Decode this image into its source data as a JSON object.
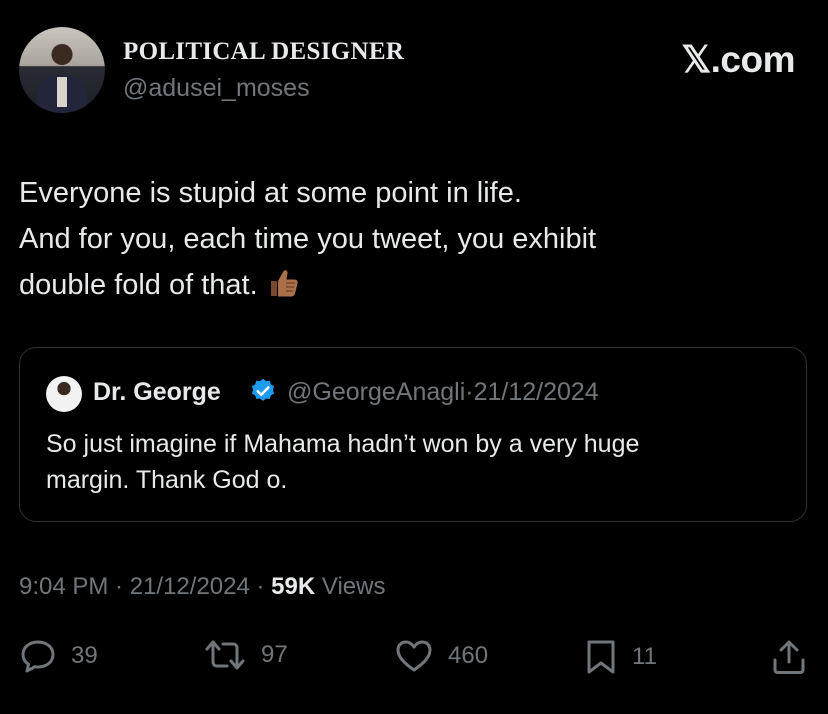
{
  "author": {
    "display_name": "POLITICAL DESIGNER",
    "handle": "@adusei_moses"
  },
  "brand": "𝕏.com",
  "tweet": {
    "lines": [
      "Everyone is stupid at some point in life.",
      "And for you, each time you tweet, you exhibit",
      "double fold of that."
    ],
    "emoji": "thumbs-up (medium-dark skin tone)"
  },
  "quoted": {
    "name": "Dr. George",
    "handle": "@GeorgeAnagli",
    "date": "21/12/2024",
    "separator": "·",
    "lines": [
      "So just imagine if Mahama hadn’t won by a very huge",
      "margin. Thank God o."
    ]
  },
  "meta": {
    "time": "9:04 PM",
    "date": "21/12/2024",
    "separator": " · ",
    "views_count": "59K",
    "views_label": "Views"
  },
  "actions": {
    "replies": "39",
    "reposts": "97",
    "likes": "460",
    "bookmarks": "11"
  },
  "colors": {
    "background": "#000000",
    "text": "#e7e9ea",
    "secondary": "#71767b",
    "border": "#2f3336",
    "verified": "#1d9bf0"
  }
}
